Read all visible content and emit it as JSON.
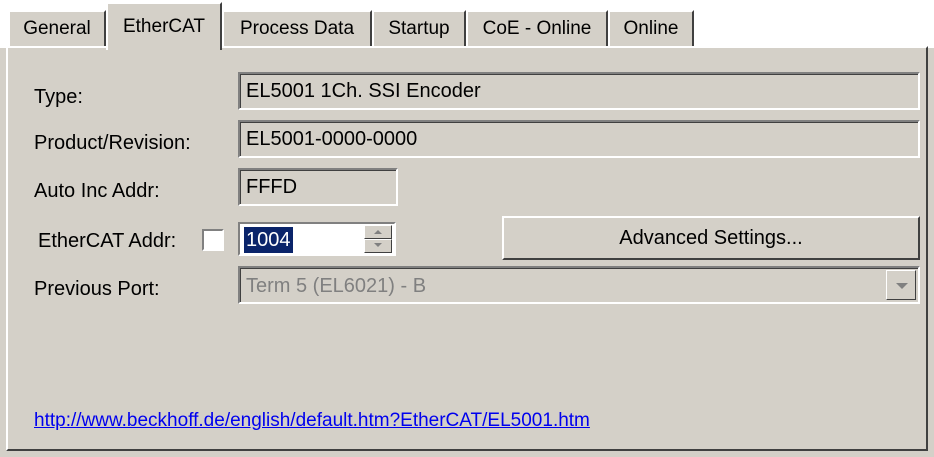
{
  "tabs": [
    {
      "label": "General"
    },
    {
      "label": "EtherCAT"
    },
    {
      "label": "Process Data"
    },
    {
      "label": "Startup"
    },
    {
      "label": "CoE - Online"
    },
    {
      "label": "Online"
    }
  ],
  "active_tab": "EtherCAT",
  "fields": {
    "type": {
      "label": "Type:",
      "value": "EL5001 1Ch. SSI Encoder"
    },
    "product_revision": {
      "label": "Product/Revision:",
      "value": "EL5001-0000-0000"
    },
    "auto_inc_addr": {
      "label": "Auto Inc Addr:",
      "value": "FFFD"
    },
    "ethercat_addr": {
      "label": "EtherCAT Addr:",
      "value": "1004",
      "checked": false
    },
    "previous_port": {
      "label": "Previous Port:",
      "value": "Term 5 (EL6021) - B"
    }
  },
  "advanced_button": {
    "label": "Advanced Settings..."
  },
  "link": {
    "text": "http://www.beckhoff.de/english/default.htm?EtherCAT/EL5001.htm"
  },
  "colors": {
    "face": "#d4d0c8",
    "link": "#0000ee",
    "selection": "#0a246a"
  }
}
